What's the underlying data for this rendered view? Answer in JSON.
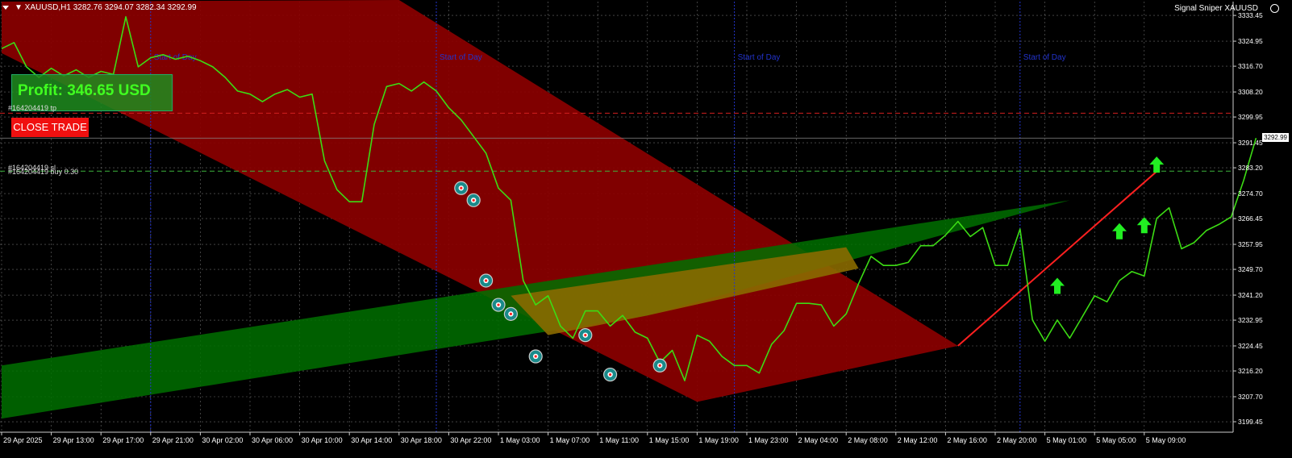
{
  "header": {
    "symbol_info": "▼ XAUUSD,H1  3282.76 3294.07 3282.34 3292.99",
    "indicator_name": "Signal Sniper XAUUSD"
  },
  "trade_panel": {
    "profit_text": "Profit: 346.65 USD",
    "close_button": "CLOSE TRADE",
    "tp_label": "#164204419 tp",
    "sl_label": "#164204419 sl",
    "order_label": "#164204419 buy 0.30"
  },
  "day_separator_label": "Start of Day",
  "colors": {
    "price_line": "#3cdc14",
    "bear_channel": "#8b0000",
    "bull_channel": "#007000",
    "overlap": "#8a6a00",
    "trend_line": "#ff2020",
    "grid": "#b4b4b4",
    "day_line": "#2233cc",
    "tp_line": "#d22020",
    "order_line": "#3cb43c",
    "buy_arrow": "#22ee22"
  },
  "chart_data": {
    "type": "line",
    "symbol": "XAUUSD",
    "timeframe": "H1",
    "ylim": [
      3196,
      3338
    ],
    "y_ticks": [
      3333.45,
      3324.95,
      3316.7,
      3308.2,
      3299.95,
      3291.45,
      3283.2,
      3274.7,
      3266.45,
      3257.95,
      3249.7,
      3241.2,
      3232.95,
      3224.45,
      3216.2,
      3207.7,
      3199.45
    ],
    "x_ticks": [
      "29 Apr 2025",
      "29 Apr 13:00",
      "29 Apr 17:00",
      "29 Apr 21:00",
      "30 Apr 02:00",
      "30 Apr 06:00",
      "30 Apr 10:00",
      "30 Apr 14:00",
      "30 Apr 18:00",
      "30 Apr 22:00",
      "1 May 03:00",
      "1 May 07:00",
      "1 May 11:00",
      "1 May 15:00",
      "1 May 19:00",
      "1 May 23:00",
      "2 May 04:00",
      "2 May 08:00",
      "2 May 12:00",
      "2 May 16:00",
      "2 May 20:00",
      "5 May 01:00",
      "5 May 05:00",
      "5 May 09:00"
    ],
    "bars_total": 98,
    "close": [
      3322.5,
      3324.5,
      3316.5,
      3313,
      3316,
      3313.5,
      3315.5,
      3313,
      3315,
      3314,
      3333,
      3316.5,
      3319.5,
      3320.5,
      3319,
      3320,
      3318.5,
      3316.5,
      3313,
      3308.5,
      3307.5,
      3305,
      3307.5,
      3309,
      3306.5,
      3307.5,
      3285.5,
      3276,
      3272,
      3272,
      3297.5,
      3310,
      3311,
      3308.5,
      3311.5,
      3308.5,
      3303,
      3299,
      3293.5,
      3288,
      3276.5,
      3272.5,
      3246,
      3238,
      3241,
      3231,
      3227,
      3236,
      3236,
      3231,
      3234.5,
      3229,
      3227,
      3219,
      3223,
      3213,
      3228,
      3226,
      3221,
      3218,
      3218,
      3215.5,
      3225,
      3229.5,
      3238.5,
      3238.5,
      3238,
      3231,
      3235,
      3245,
      3254,
      3251,
      3251,
      3252,
      3257.5,
      3257.5,
      3261,
      3265.5,
      3260.5,
      3263.5,
      3251,
      3251,
      3263,
      3233,
      3226,
      3233,
      3227,
      3234,
      3241,
      3239,
      3246,
      3249,
      3247.5,
      3266.5,
      3270,
      3256.5,
      3258.5,
      3262.5,
      3264.5,
      3267,
      3279,
      3293
    ],
    "current_price": 3292.99,
    "take_profit": 3301.2,
    "order_price": 3282.1,
    "order_label": "#164204419 buy 0.30",
    "day_separators": [
      "30 Apr",
      "1 May",
      "2 May",
      "5 May"
    ],
    "bear_channel": {
      "start": [
        "29 Apr 2025",
        3338
      ],
      "end_bottom": [
        "1 May 15:00",
        3206
      ],
      "end_top": [
        "2 May 16:00",
        3224.5
      ]
    },
    "bull_channel": {
      "bottom": [
        [
          0,
          3200.5
        ],
        [
          52,
          3234.5
        ],
        [
          86,
          3272.5
        ]
      ],
      "top": [
        [
          0,
          3218
        ],
        [
          86,
          3272.5
        ]
      ]
    },
    "trend_line": [
      [
        77,
        3224.5
      ],
      [
        93,
        3282
      ]
    ],
    "markers_sell": [
      [
        37,
        3276.5
      ],
      [
        38,
        3272.5
      ],
      [
        39,
        3246
      ],
      [
        40,
        3238
      ],
      [
        41,
        3235
      ],
      [
        43,
        3221
      ],
      [
        47,
        3228
      ],
      [
        49,
        3215
      ],
      [
        53,
        3218
      ]
    ],
    "buy_arrows": [
      [
        85,
        3244
      ],
      [
        90,
        3262
      ],
      [
        92,
        3264
      ],
      [
        93,
        3284
      ]
    ]
  }
}
